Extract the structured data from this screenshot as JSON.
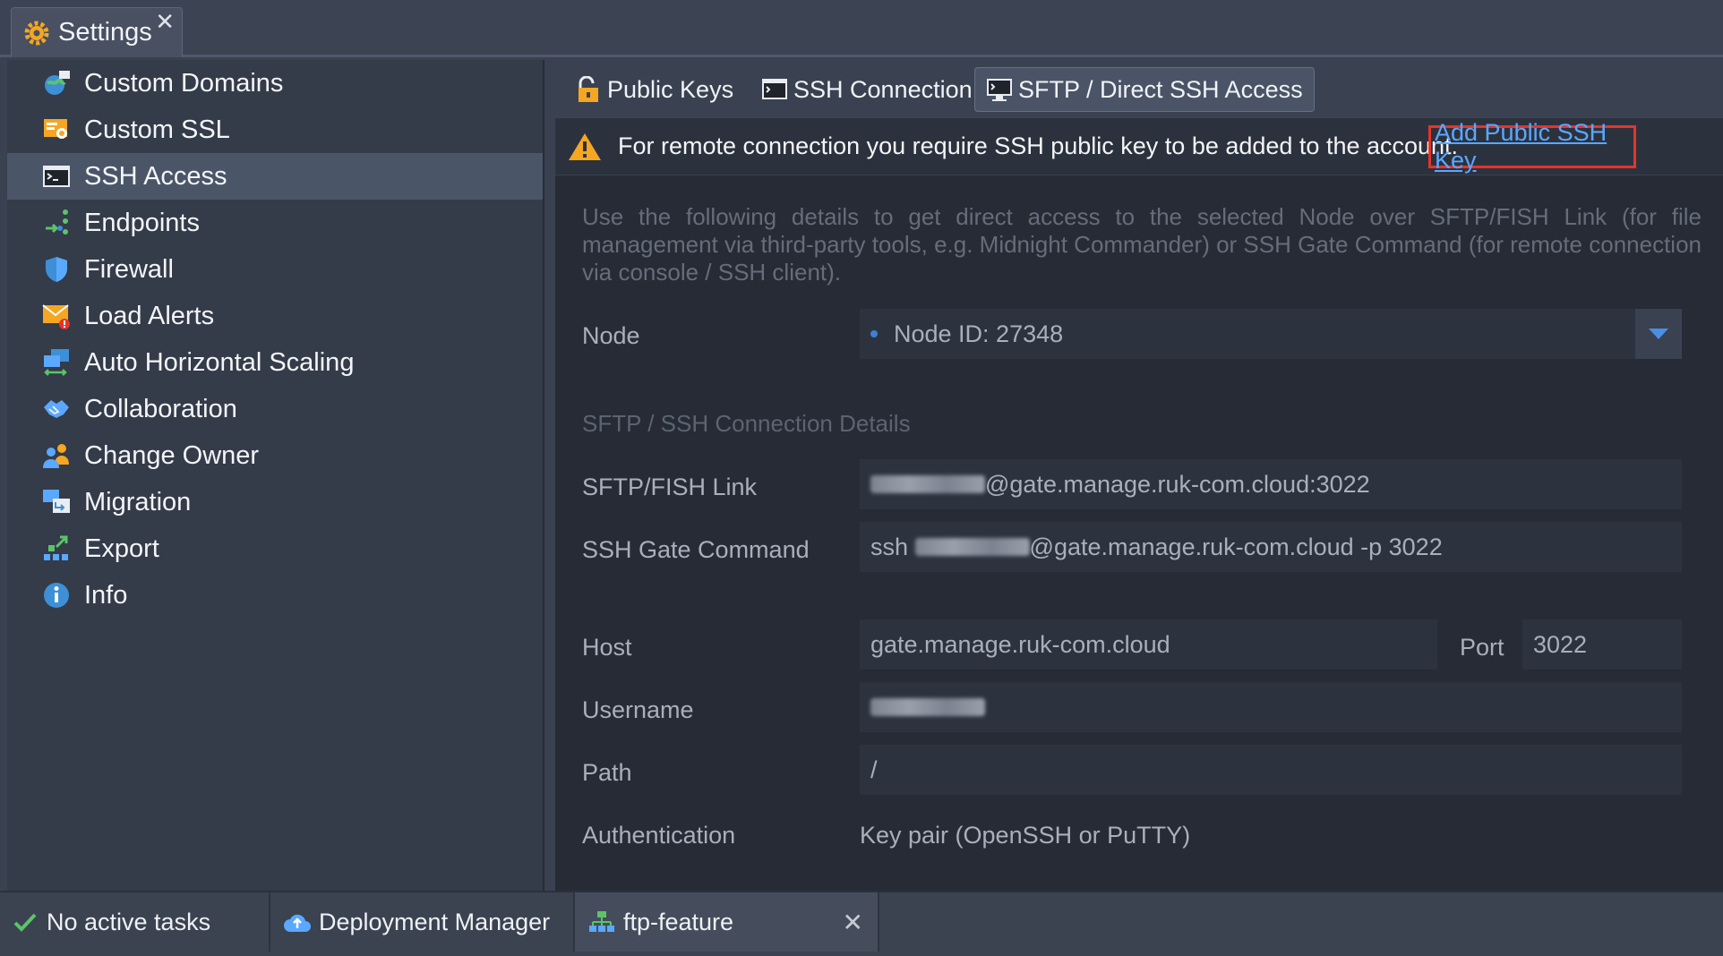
{
  "window_tab": {
    "title": "Settings",
    "close": "✕"
  },
  "sidebar": {
    "items": [
      {
        "label": "Custom Domains",
        "icon": "globe-icon"
      },
      {
        "label": "Custom SSL",
        "icon": "certificate-icon"
      },
      {
        "label": "SSH Access",
        "icon": "terminal-icon",
        "active": true
      },
      {
        "label": "Endpoints",
        "icon": "endpoints-icon"
      },
      {
        "label": "Firewall",
        "icon": "shield-icon"
      },
      {
        "label": "Load Alerts",
        "icon": "mail-alert-icon"
      },
      {
        "label": "Auto Horizontal Scaling",
        "icon": "scaling-icon"
      },
      {
        "label": "Collaboration",
        "icon": "handshake-icon"
      },
      {
        "label": "Change Owner",
        "icon": "users-icon"
      },
      {
        "label": "Migration",
        "icon": "migration-icon"
      },
      {
        "label": "Export",
        "icon": "export-icon"
      },
      {
        "label": "Info",
        "icon": "info-icon"
      }
    ]
  },
  "tabs": [
    {
      "label": "Public Keys",
      "icon": "padlock-icon"
    },
    {
      "label": "SSH Connection",
      "icon": "terminal-icon"
    },
    {
      "label": "SFTP / Direct SSH Access",
      "icon": "monitor-terminal-icon",
      "active": true
    }
  ],
  "warning": {
    "text": "For remote connection you require SSH public key to be added to the account.",
    "link": "Add Public SSH Key"
  },
  "description": "Use the following details to get direct access to the selected Node over SFTP/FISH Link (for file management via third-party tools, e.g. Midnight Commander) or SSH Gate Command (for remote connection via console / SSH client).",
  "form": {
    "node_label": "Node",
    "node_value": "Node ID: 27348",
    "section_title": "SFTP / SSH Connection Details",
    "sftp_label": "SFTP/FISH Link",
    "sftp_value": "@gate.manage.ruk-com.cloud:3022",
    "ssh_label": "SSH Gate Command",
    "ssh_prefix": "ssh",
    "ssh_value": "@gate.manage.ruk-com.cloud -p 3022",
    "host_label": "Host",
    "host_value": "gate.manage.ruk-com.cloud",
    "port_label": "Port",
    "port_value": "3022",
    "username_label": "Username",
    "path_label": "Path",
    "path_value": "/",
    "auth_label": "Authentication",
    "auth_value": "Key pair (OpenSSH or PuTTY)"
  },
  "bottombar": {
    "tasks": "No active tasks",
    "deployment": "Deployment Manager",
    "env": "ftp-feature",
    "close": "✕"
  },
  "colors": {
    "accent_link": "#5aa8ff",
    "highlight_border": "#e5342b",
    "warning": "#f5a623"
  }
}
